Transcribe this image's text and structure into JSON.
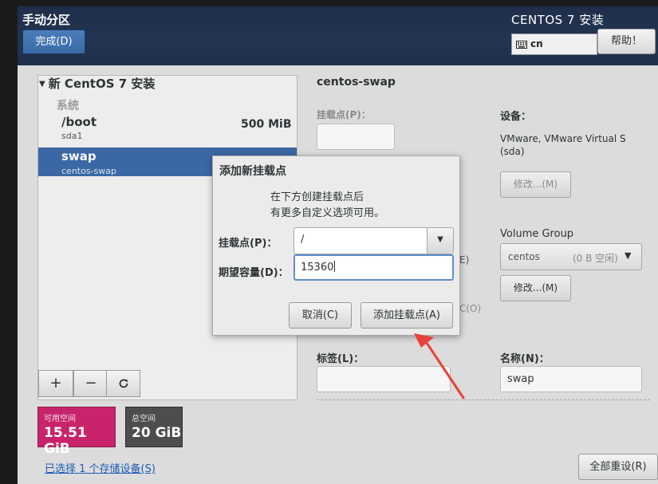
{
  "header": {
    "spoke_title": "手动分区",
    "done_label": "完成(D)",
    "product_title": "CENTOS 7 安装",
    "keyboard_layout": "cn",
    "help_label": "帮助！"
  },
  "tree": {
    "header": "新 CentOS 7 安装",
    "group": "系统",
    "items": [
      {
        "mount": "/boot",
        "device": "sda1",
        "size": "500 MiB"
      },
      {
        "mount": "swap",
        "device": "centos-swap"
      }
    ]
  },
  "toolbar": {
    "add_symbol": "+",
    "remove_symbol": "−",
    "refresh_symbol": "⟳"
  },
  "space": {
    "available_label": "可用空间",
    "available_value": "15.51 GiB",
    "total_label": "总空间",
    "total_value": "20 GiB"
  },
  "storage_link": "已选择 1 个存储设备(S)",
  "reset_label": "全部重设(R)",
  "details": {
    "title": "centos-swap",
    "mount_label": "挂载点(P)：",
    "device_label": "设备：",
    "device_value": "VMware, VMware Virtual S (sda)",
    "modify_label": "修改...(M)",
    "vg_label": "Volume Group",
    "vg_value": "centos",
    "vg_free": "(0 B 空闲)",
    "modify_vg_label": "修改...(M)",
    "partial_e": "E)",
    "partial_o": "C(O)",
    "tag_label": "标签(L)：",
    "name_label": "名称(N)：",
    "name_value": "swap"
  },
  "dialog": {
    "title": "添加新挂载点",
    "desc_line1": "在下方创建挂载点后",
    "desc_line2": "有更多自定义选项可用。",
    "mount_label": "挂载点(P)：",
    "mount_value": "/",
    "size_label": "期望容量(D)：",
    "size_value": "15360",
    "cancel_label": "取消(C)",
    "add_label": "添加挂载点(A)"
  },
  "colors": {
    "header_bg": "#233453",
    "selection": "#3b68a4",
    "available": "#c7246b",
    "total": "#4d4d4d",
    "annotation_arrow": "#e8413a"
  }
}
